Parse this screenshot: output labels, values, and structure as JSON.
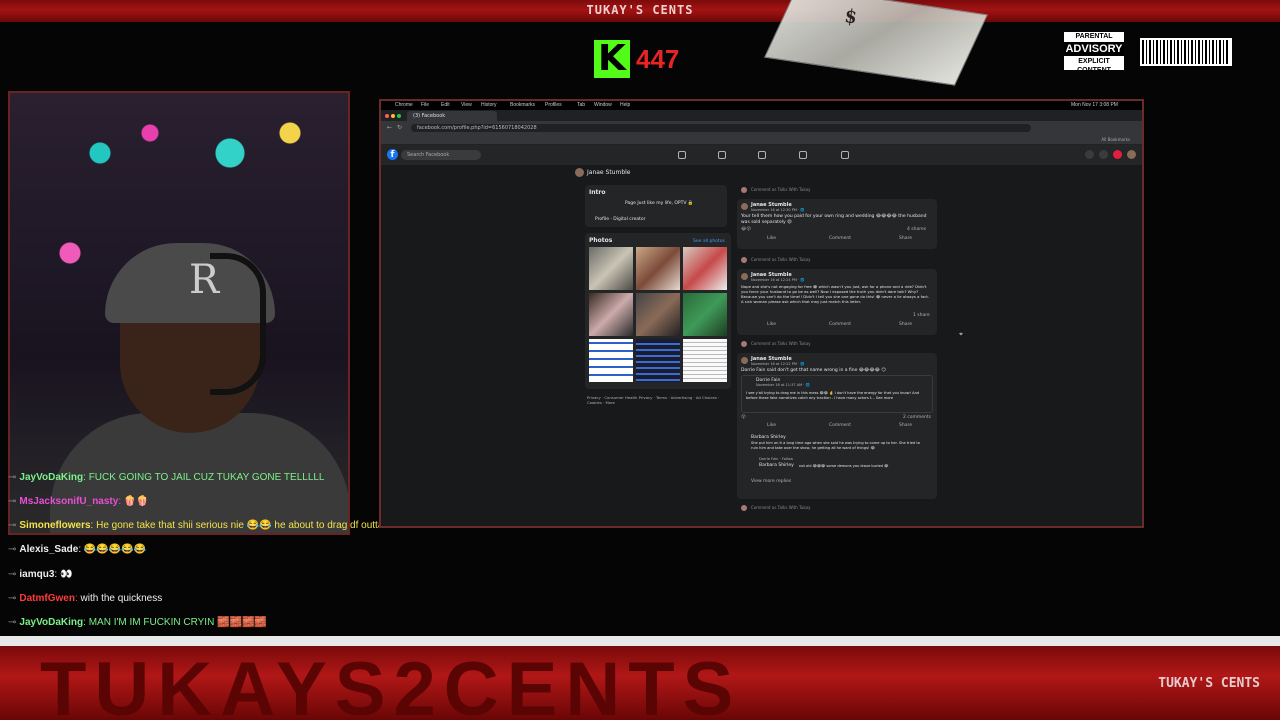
{
  "overlay": {
    "top_title": "TUKAY'S CENTS",
    "viewer_count": "447",
    "kick_logo": "K",
    "advisory_line1": "PARENTAL",
    "advisory_line2": "ADVISORY",
    "advisory_line3": "EXPLICIT CONTENT",
    "bottom_watermark": "TUKAYS2CENTS",
    "bottom_logo": "TUKAY'S CENTS",
    "brand_red": "#a41313",
    "kick_green": "#53fc18"
  },
  "webcam": {
    "cap_letter": "R"
  },
  "chat": [
    {
      "user": "JayVoDaKing",
      "message": "FUCK GOING TO JAIL CUZ TUKAY GONE TELLLLL",
      "user_color": "#7cf08a",
      "msg_color": "#7cf08a"
    },
    {
      "user": "MsJacksonifU_nasty",
      "message": "🍿🍿",
      "user_color": "#e84fd6",
      "msg_color": "#eeeeee"
    },
    {
      "user": "Simoneflowers",
      "message": "He gone take that shii serious nie 😂😂 he about to drag df outta that",
      "user_color": "#f3e24a",
      "msg_color": "#f3e24a"
    },
    {
      "user": "Alexis_Sade",
      "message": "😂😂😂😂😂",
      "user_color": "#eeeeee",
      "msg_color": "#eeeeee"
    },
    {
      "user": "iamqu3",
      "message": "👀",
      "user_color": "#eeeeee",
      "msg_color": "#eeeeee"
    },
    {
      "user": "DatmfGwen",
      "message": "with the quickness",
      "user_color": "#ff3b3b",
      "msg_color": "#eeeeee"
    },
    {
      "user": "JayVoDaKing",
      "message": "MAN I'M IM FUCKIN CRYIN 🧱🧱🧱🧱",
      "user_color": "#7cf08a",
      "msg_color": "#7cf08a"
    }
  ],
  "browser": {
    "menu_items": [
      "Chrome",
      "File",
      "Edit",
      "View",
      "History",
      "Bookmarks",
      "Profiles",
      "Tab",
      "Window",
      "Help"
    ],
    "clock": "Mon Nov 17  3:08 PM",
    "tab_title": "(3) Facebook",
    "url": "facebook.com/profile.php?id=61560718042028",
    "bookmarks_label": "All Bookmarks"
  },
  "facebook": {
    "search_placeholder": "Search Facebook",
    "profile_name": "Janae Stumble",
    "intro": {
      "title": "Intro",
      "bio": "Page Just like my life, OPTV 🔒",
      "category_label": "Profile · Digital creator"
    },
    "photos": {
      "title": "Photos",
      "see_all": "See all photos"
    },
    "footer": "Privacy · Consumer Health Privacy · Terms · Advertising · Ad Choices · Cookies · More",
    "posts": [
      {
        "name": "Janae Stumble",
        "time": "November 16 at 12:30 PM · 🌐",
        "text": "Your tell them how you paid for your own ring and wedding 😂😂😂😂 the husband was sold separately 😩",
        "reactions": "😂😮",
        "comments_count": "4 shares",
        "like": "Like",
        "comment": "Comment",
        "share": "Share"
      },
      {
        "name": "Janae Stumble",
        "time": "November 16 at 12:24 PM · 🌐",
        "text": "Nope and she's not engaging for free 😂 which wasn't you just, ask for a phone and a ride? Didn't you force your husband to go be as well? Now I exposed the truth you didn't dare talk? Why? Because you can't do the time!! Didn't I tell you she one gone do this! 😂 never a lie always a fact. A sick woman please ask which that may just match this letter.",
        "reactions": "",
        "comments_count": "1 share",
        "like": "Like",
        "comment": "Comment",
        "share": "Share"
      },
      {
        "name": "Janae Stumble",
        "time": "November 16 at 12:22 PM · 🌐",
        "text": "Dorrie Fain said don't get that name wrong in a fine 😂😂😂😂 😏",
        "shared_name": "Dorrie Fain",
        "shared_time": "November 16 at 11:37 AM · 🌐",
        "shared_text": "I see y'all trying to drag me in this mess 😂😂 🤞 I don't have the energy for that you know! And before these fake narratives catch any traction - I have many actors t... See more",
        "reactions": "😮",
        "comments_count": "2 comments",
        "like": "Like",
        "comment": "Comment",
        "share": "Share",
        "reply_name": "Barbara Shirley",
        "reply_text": "She put him on it a long time ago when she said he was trying to come up to her. She tried to ruin him and take over the show, he getting all he want of things! 😂",
        "reply_name2": "Dorrie Fain · Follow",
        "reply_name3": "Barbara Shirley",
        "reply_text3": "not old 😂😂😂 some demons you leave buried 😂",
        "more_replies": "View more replies"
      }
    ],
    "comment_as": "Comment as Talks With Tukay"
  }
}
